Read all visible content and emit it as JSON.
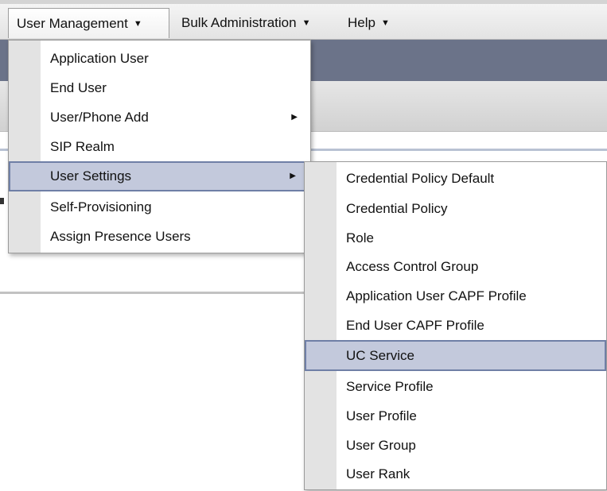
{
  "menubar": {
    "items": [
      {
        "label": "User Management"
      },
      {
        "label": "Bulk Administration"
      },
      {
        "label": "Help"
      }
    ]
  },
  "user_management_menu": {
    "items": [
      {
        "label": "Application User"
      },
      {
        "label": "End User"
      },
      {
        "label": "User/Phone Add"
      },
      {
        "label": "SIP Realm"
      },
      {
        "label": "User Settings"
      },
      {
        "label": "Self-Provisioning"
      },
      {
        "label": "Assign Presence Users"
      }
    ]
  },
  "user_settings_menu": {
    "items": [
      {
        "label": "Credential Policy Default"
      },
      {
        "label": "Credential Policy"
      },
      {
        "label": "Role"
      },
      {
        "label": "Access Control Group"
      },
      {
        "label": "Application User CAPF Profile"
      },
      {
        "label": "End User CAPF Profile"
      },
      {
        "label": "UC Service"
      },
      {
        "label": "Service Profile"
      },
      {
        "label": "User Profile"
      },
      {
        "label": "User Group"
      },
      {
        "label": "User Rank"
      }
    ]
  },
  "colors": {
    "menu_highlight": "#c3c9dc",
    "menu_highlight_border": "#6f7fa6",
    "header_band": "#6b7389"
  }
}
